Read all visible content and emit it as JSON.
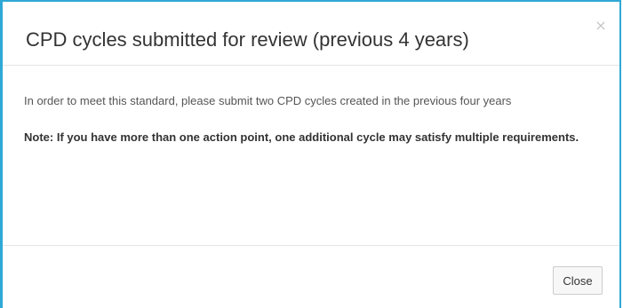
{
  "modal": {
    "title": "CPD cycles submitted for review (previous 4 years)",
    "close_icon": "×",
    "body": {
      "intro": "In order to meet this standard, please submit two CPD cycles created in the previous four years",
      "note": "Note: If you have more than one action point, one additional cycle may satisfy multiple requirements."
    },
    "footer": {
      "close_label": "Close"
    }
  },
  "colors": {
    "accent_border": "#2fa8d6",
    "button_background": "#f7f7f7",
    "divider": "#e5e5e5"
  }
}
